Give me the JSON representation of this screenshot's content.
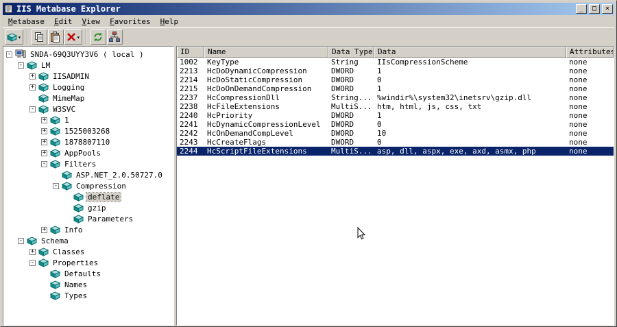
{
  "window": {
    "title": "IIS Metabase Explorer",
    "controls": {
      "minimize": "_",
      "maximize": "□",
      "close": "×"
    }
  },
  "menu": {
    "items": [
      {
        "label": "Metabase"
      },
      {
        "label": "Edit"
      },
      {
        "label": "View"
      },
      {
        "label": "Favorites"
      },
      {
        "label": "Help"
      }
    ]
  },
  "toolbar": {
    "buttons": [
      {
        "name": "new-key",
        "dropdown": true
      },
      {
        "separator": true
      },
      {
        "name": "copy"
      },
      {
        "name": "paste"
      },
      {
        "name": "delete",
        "dropdown": true
      },
      {
        "separator": true
      },
      {
        "name": "refresh"
      },
      {
        "name": "connect"
      }
    ]
  },
  "tree": {
    "nodes": [
      {
        "depth": 0,
        "toggle": "minus",
        "icon": "computer",
        "label": "SNDA-69Q3UYY3V6 ( local )",
        "selected": false
      },
      {
        "depth": 1,
        "toggle": "minus",
        "icon": "node",
        "label": "LM",
        "selected": false
      },
      {
        "depth": 2,
        "toggle": "plus",
        "icon": "node",
        "label": "IISADMIN",
        "selected": false
      },
      {
        "depth": 2,
        "toggle": "plus",
        "icon": "node",
        "label": "Logging",
        "selected": false
      },
      {
        "depth": 2,
        "toggle": "none",
        "icon": "node",
        "label": "MimeMap",
        "selected": false
      },
      {
        "depth": 2,
        "toggle": "minus",
        "icon": "node",
        "label": "W3SVC",
        "selected": false
      },
      {
        "depth": 3,
        "toggle": "plus",
        "icon": "node",
        "label": "1",
        "selected": false
      },
      {
        "depth": 3,
        "toggle": "plus",
        "icon": "node",
        "label": "1525003268",
        "selected": false
      },
      {
        "depth": 3,
        "toggle": "plus",
        "icon": "node",
        "label": "1878807110",
        "selected": false
      },
      {
        "depth": 3,
        "toggle": "plus",
        "icon": "node",
        "label": "AppPools",
        "selected": false
      },
      {
        "depth": 3,
        "toggle": "minus",
        "icon": "node",
        "label": "Filters",
        "selected": false
      },
      {
        "depth": 4,
        "toggle": "none",
        "icon": "node",
        "label": "ASP.NET_2.0.50727.0",
        "selected": false
      },
      {
        "depth": 4,
        "toggle": "minus",
        "icon": "node",
        "label": "Compression",
        "selected": false
      },
      {
        "depth": 5,
        "toggle": "none",
        "icon": "node",
        "label": "deflate",
        "selected": true
      },
      {
        "depth": 5,
        "toggle": "none",
        "icon": "node",
        "label": "gzip",
        "selected": false
      },
      {
        "depth": 5,
        "toggle": "none",
        "icon": "node",
        "label": "Parameters",
        "selected": false
      },
      {
        "depth": 3,
        "toggle": "plus",
        "icon": "node",
        "label": "Info",
        "selected": false
      },
      {
        "depth": 1,
        "toggle": "minus",
        "icon": "node",
        "label": "Schema",
        "selected": false
      },
      {
        "depth": 2,
        "toggle": "plus",
        "icon": "node",
        "label": "Classes",
        "selected": false
      },
      {
        "depth": 2,
        "toggle": "minus",
        "icon": "node",
        "label": "Properties",
        "selected": false
      },
      {
        "depth": 3,
        "toggle": "none",
        "icon": "node",
        "label": "Defaults",
        "selected": false
      },
      {
        "depth": 3,
        "toggle": "none",
        "icon": "node",
        "label": "Names",
        "selected": false
      },
      {
        "depth": 3,
        "toggle": "none",
        "icon": "node",
        "label": "Types",
        "selected": false
      }
    ]
  },
  "table": {
    "columns": [
      "ID",
      "Name",
      "Data Type",
      "Data",
      "Attributes"
    ],
    "selected_id": "2244",
    "rows": [
      [
        "1002",
        "KeyType",
        "String",
        "IIsCompressionScheme",
        "none"
      ],
      [
        "2213",
        "HcDoDynamicCompression",
        "DWORD",
        "1",
        "none"
      ],
      [
        "2214",
        "HcDoStaticCompression",
        "DWORD",
        "0",
        "none"
      ],
      [
        "2215",
        "HcDoOnDemandCompression",
        "DWORD",
        "1",
        "none"
      ],
      [
        "2237",
        "HcCompressionDll",
        "String...",
        "%windir%\\system32\\inetsrv\\gzip.dll",
        "none"
      ],
      [
        "2238",
        "HcFileExtensions",
        "MultiS...",
        "htm, html, js, css, txt",
        "none"
      ],
      [
        "2240",
        "HcPriority",
        "DWORD",
        "1",
        "none"
      ],
      [
        "2241",
        "HcDynamicCompressionLevel",
        "DWORD",
        "0",
        "none"
      ],
      [
        "2242",
        "HcOnDemandCompLevel",
        "DWORD",
        "10",
        "none"
      ],
      [
        "2243",
        "HcCreateFlags",
        "DWORD",
        "0",
        "none"
      ],
      [
        "2244",
        "HcScriptFileExtensions",
        "MultiS...",
        "asp, dll, aspx, exe, axd, asmx, php",
        "none"
      ]
    ]
  }
}
